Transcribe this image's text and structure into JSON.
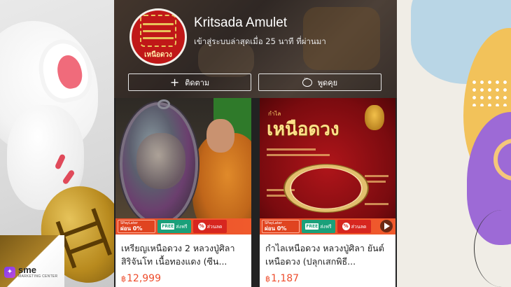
{
  "shop": {
    "name": "Kritsada Amulet",
    "status": "เข้าสู่ระบบล่าสุดเมื่อ 25 นาที ที่ผ่านมา",
    "avatar_text": "เหนือดวง",
    "follow_label": "ติดตาม",
    "chat_label": "พูดคุย"
  },
  "products": [
    {
      "title": "เหรียญเหนือดวง 2 หลวงปู่ศิลา สิริจันโท เนื้อทองแดง (ซีน...",
      "currency": "฿",
      "price": "12,999"
    },
    {
      "title": "กำไลเหนือดวง หลวงปู่ศิลา ยันต์เหนือดวง (ปลุกเสกพิธี...",
      "currency": "฿",
      "price": "1,187",
      "image_small_text": "กำไล",
      "image_big_text": "เหนือดวง"
    }
  ],
  "promo": {
    "spay_line1": "SPayLater",
    "spay_line2": "ผ่อน 0%",
    "ship_tag": "FREE",
    "ship_text": "ส่งฟรี",
    "disc_text": "ส่วนลด"
  },
  "branding": {
    "sme_main": "sme",
    "sme_sub": "MARKETING CENTER"
  },
  "colors": {
    "price": "#ee4d2d",
    "promo_bar": "#e84f2a",
    "avatar_red": "#c01818"
  }
}
